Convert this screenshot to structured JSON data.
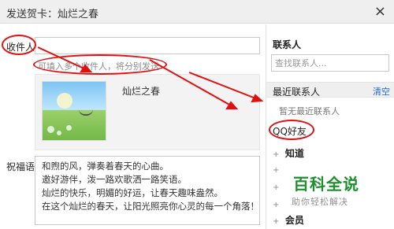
{
  "window": {
    "title": "发送贺卡：灿烂之春",
    "close_glyph": "×"
  },
  "recipient": {
    "label": "收件人",
    "value": "",
    "hint": "可填入多个收件人，将分别发送"
  },
  "card": {
    "name": "灿烂之春"
  },
  "message": {
    "label": "祝福语",
    "lines": [
      "和煦的风，弹奏着春天的心曲。",
      "邀好游伴，泼一路欢歌洒一路笑语。",
      "灿烂的快乐，明媚的好运，让春天趣味盎然。",
      "在这个灿烂的春天，让阳光照亮你心灵的每一个角落！"
    ]
  },
  "contacts": {
    "title": "联系人",
    "search_placeholder": "查找联系人...",
    "recent_title": "最近联系人",
    "clear_label": "清空",
    "no_recent": "暂无最近联系人",
    "qq_friends": "QQ好友",
    "groups": [
      {
        "label": "知道",
        "expand": "+"
      },
      {
        "label": "",
        "expand": "+"
      },
      {
        "label": "",
        "expand": "+"
      },
      {
        "label": "",
        "expand": "+"
      },
      {
        "label": "会员",
        "expand": "+"
      }
    ]
  },
  "watermark": {
    "title": "百科全说",
    "subtitle": "助你轻松解决"
  },
  "annotation_color": "#e01010"
}
